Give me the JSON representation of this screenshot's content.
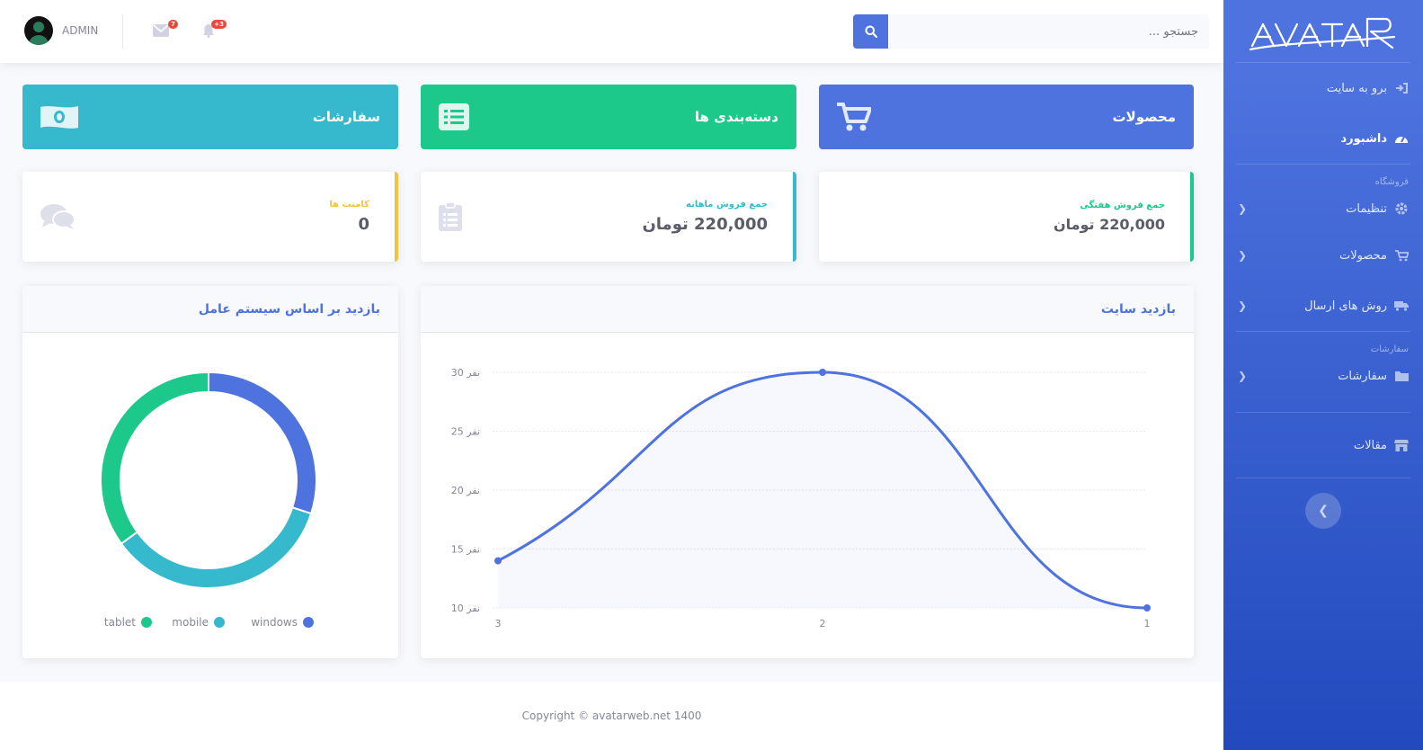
{
  "brand": {
    "logo_text": "AVATAR"
  },
  "topbar": {
    "search_placeholder": "جستجو ...",
    "user_name": "ADMIN",
    "messages_count": "7",
    "alerts_count": "+3"
  },
  "sidebar": {
    "go_to_site": "برو به سایت",
    "dashboard": "داشبورد",
    "heading_shop": "فروشگاه",
    "settings": "تنظیمات",
    "products": "محصولات",
    "shipping": "روش های ارسال",
    "heading_orders": "سفارشات",
    "orders": "سفارشات",
    "articles": "مقالات"
  },
  "tiles": {
    "products": "محصولات",
    "categories": "دسته‌بندی ها",
    "orders": "سفارشات"
  },
  "stats": {
    "weekly_title": "جمع فروش هفتگی",
    "weekly_value": "220,000 تومان",
    "monthly_title": "جمع فروش ماهانه",
    "monthly_value": "220,000 تومان",
    "comments_title": "کامنت ها",
    "comments_value": "0"
  },
  "visits_card": {
    "title": "بازدید سایت"
  },
  "os_card": {
    "title": "بازدید بر اساس سیستم عامل"
  },
  "colors": {
    "primary": "#4e73df",
    "success": "#1cc88a",
    "info": "#36b9cc",
    "warning": "#f6c23e"
  },
  "chart_data": [
    {
      "type": "area",
      "title": "بازدید سایت",
      "x": [
        "3",
        "2",
        "1"
      ],
      "series": [
        {
          "values": [
            14,
            30,
            10
          ]
        }
      ],
      "yticks": [
        "10 نفر",
        "15 نفر",
        "20 نفر",
        "25 نفر",
        "30 نفر"
      ],
      "ylim": [
        10,
        30
      ],
      "grid": true
    },
    {
      "type": "pie",
      "title": "بازدید بر اساس سیستم عامل",
      "labels": [
        "windows",
        "mobile",
        "tablet"
      ],
      "values": [
        30,
        35,
        35
      ],
      "colors": [
        "#4e73df",
        "#36b9cc",
        "#1cc88a"
      ],
      "legend": "bottom"
    }
  ],
  "footer": {
    "copyright": "Copyright © avatarweb.net 1400"
  }
}
